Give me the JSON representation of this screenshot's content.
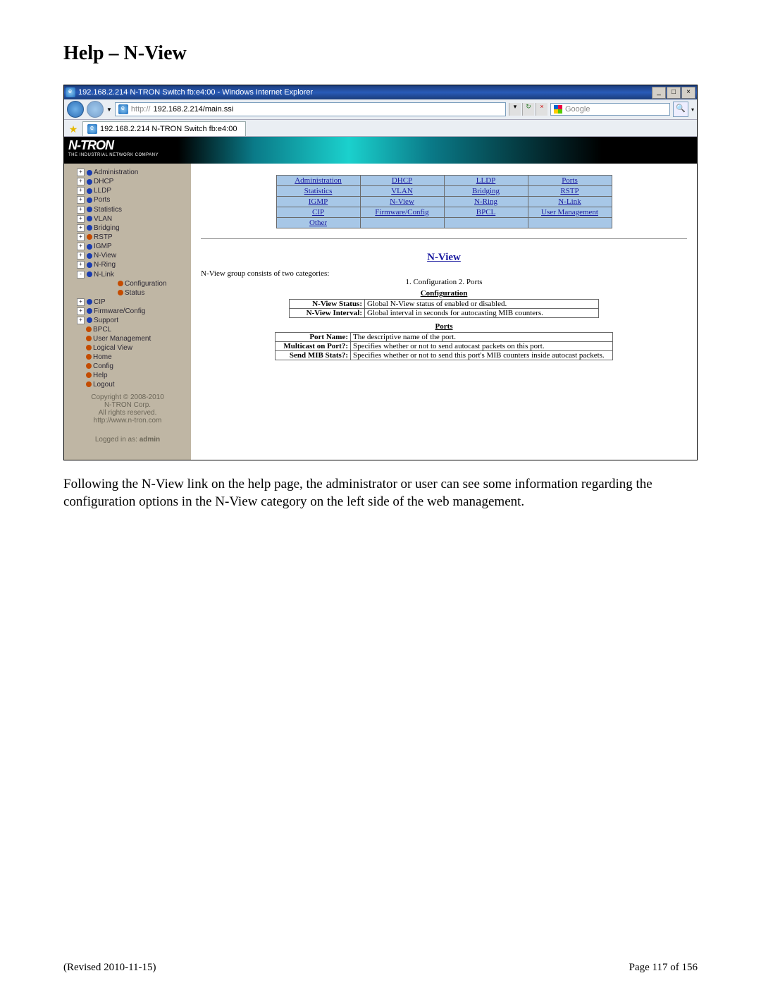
{
  "doc": {
    "title": "Help – N-View",
    "paragraph": "Following the N-View link on the help page, the administrator or user can see some information regarding the configuration options in the N-View category on the left side of the web management.",
    "revised": "(Revised 2010-11-15)",
    "page": "Page 117 of 156"
  },
  "window": {
    "title": "192.168.2.214 N-TRON Switch fb:e4:00 - Windows Internet Explorer",
    "url_prefix": "http://",
    "url": "192.168.2.214/main.ssi",
    "search_engine": "Google",
    "tab_title": "192.168.2.214 N-TRON Switch fb:e4:00"
  },
  "banner": {
    "logo": "N-TRON",
    "logo_sub": "THE INDUSTRIAL NETWORK COMPANY"
  },
  "sidebar": {
    "items": [
      {
        "label": "Administration",
        "plus": true,
        "color": "#1a3cb0"
      },
      {
        "label": "DHCP",
        "plus": true,
        "color": "#1a3cb0"
      },
      {
        "label": "LLDP",
        "plus": true,
        "color": "#1a3cb0"
      },
      {
        "label": "Ports",
        "plus": true,
        "color": "#1a3cb0"
      },
      {
        "label": "Statistics",
        "plus": true,
        "color": "#1a3cb0"
      },
      {
        "label": "VLAN",
        "plus": true,
        "color": "#1a3cb0"
      },
      {
        "label": "Bridging",
        "plus": true,
        "color": "#1a3cb0"
      },
      {
        "label": "RSTP",
        "plus": true,
        "color": "#c44b00"
      },
      {
        "label": "IGMP",
        "plus": true,
        "color": "#1a3cb0"
      },
      {
        "label": "N-View",
        "plus": true,
        "color": "#1a3cb0"
      },
      {
        "label": "N-Ring",
        "plus": true,
        "color": "#1a3cb0"
      },
      {
        "label": "N-Link",
        "plus": false,
        "minus": true,
        "color": "#1a3cb0"
      }
    ],
    "nlink_sub": [
      {
        "label": "Configuration",
        "color": "#c44b00"
      },
      {
        "label": "Status",
        "color": "#c44b00"
      }
    ],
    "items2": [
      {
        "label": "CIP",
        "plus": true,
        "color": "#1a3cb0"
      },
      {
        "label": "Firmware/Config",
        "plus": true,
        "color": "#1a3cb0"
      },
      {
        "label": "Support",
        "plus": true,
        "color": "#1a3cb0"
      },
      {
        "label": "BPCL",
        "plus": false,
        "color": "#c44b00"
      },
      {
        "label": "User Management",
        "plus": false,
        "color": "#c44b00"
      },
      {
        "label": "Logical View",
        "plus": false,
        "color": "#c44b00"
      },
      {
        "label": "Home",
        "plus": false,
        "color": "#c44b00"
      },
      {
        "label": "Config",
        "plus": false,
        "color": "#c44b00"
      },
      {
        "label": "Help",
        "plus": false,
        "color": "#c44b00"
      },
      {
        "label": "Logout",
        "plus": false,
        "color": "#c44b00"
      }
    ],
    "copyright1": "Copyright © 2008-2010",
    "copyright2": "N-TRON Corp.",
    "copyright3": "All rights reserved.",
    "copyright4": "http://www.n-tron.com",
    "logged": "Logged in as:",
    "user": "admin"
  },
  "helpgrid": {
    "rows": [
      [
        "Administration",
        "DHCP",
        "LLDP",
        "Ports"
      ],
      [
        "Statistics",
        "VLAN",
        "Bridging",
        "RSTP"
      ],
      [
        "IGMP",
        "N-View",
        "N-Ring",
        "N-Link"
      ],
      [
        "CIP",
        "Firmware/Config",
        "BPCL",
        "User Management"
      ],
      [
        "Other",
        "",
        "",
        ""
      ]
    ]
  },
  "help": {
    "section_title": "N-View",
    "intro": "N-View group consists of two categories:",
    "cats": "1. Configuration  2. Ports",
    "config_head": "Configuration",
    "config_rows": [
      [
        "N-View Status:",
        "Global N-View status of enabled or disabled."
      ],
      [
        "N-View Interval:",
        "Global interval in seconds for autocasting MIB counters."
      ]
    ],
    "ports_head": "Ports",
    "ports_rows": [
      [
        "Port Name:",
        "The descriptive name of the port."
      ],
      [
        "Multicast on Port?:",
        "Specifies whether or not to send autocast packets on this port."
      ],
      [
        "Send MIB Stats?:",
        "Specifies whether or not to send this port's MIB counters inside autocast packets."
      ]
    ]
  }
}
